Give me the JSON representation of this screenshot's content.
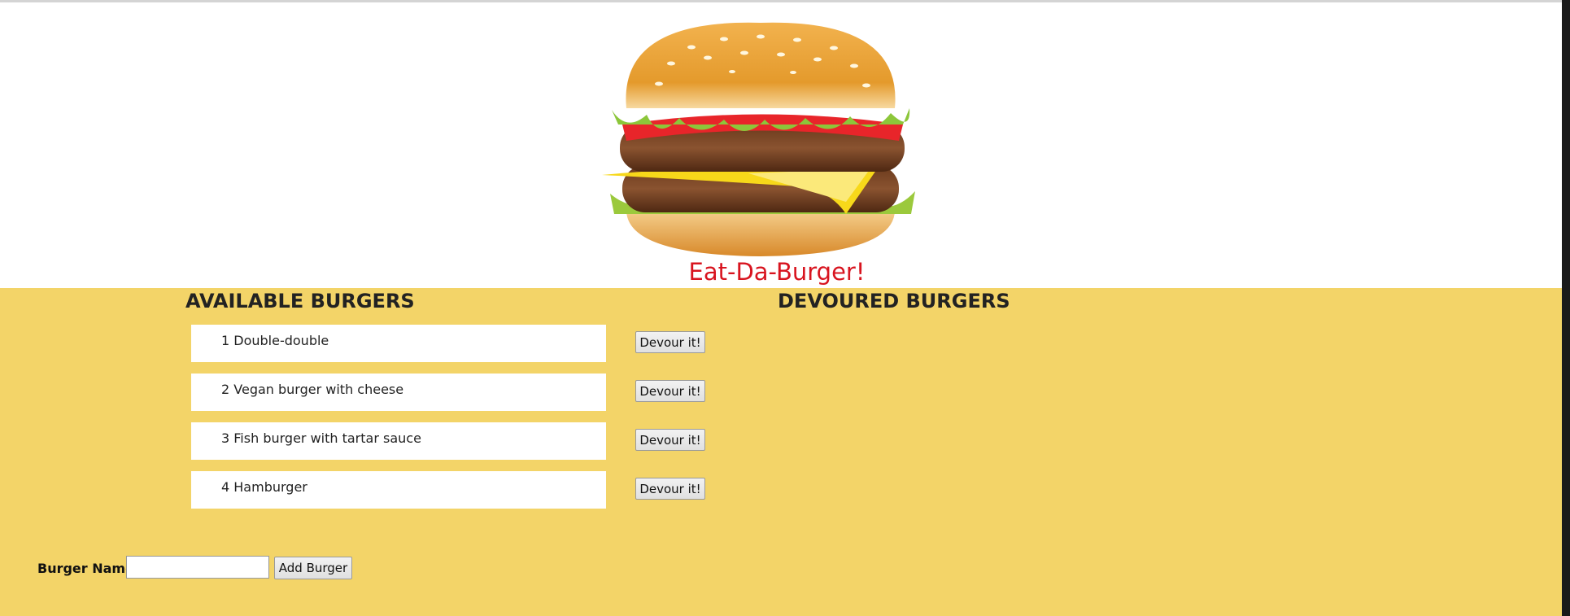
{
  "header": {
    "logo_icon": "hamburger-illustration",
    "title": "Eat-Da-Burger!",
    "title_color": "#d8141f"
  },
  "main": {
    "background": "#f3d468",
    "available_title": "AVAILABLE BURGERS",
    "devoured_title": "DEVOURED BURGERS",
    "burgers": [
      {
        "label": "1 Double-double",
        "button": "Devour it!"
      },
      {
        "label": "2 Vegan burger with cheese",
        "button": "Devour it!"
      },
      {
        "label": "3 Fish burger with tartar sauce",
        "button": "Devour it!"
      },
      {
        "label": "4 Hamburger",
        "button": "Devour it!"
      }
    ],
    "devoured": []
  },
  "form": {
    "label": "Burger Name:",
    "value": "",
    "placeholder": "",
    "submit_label": "Add Burger"
  }
}
